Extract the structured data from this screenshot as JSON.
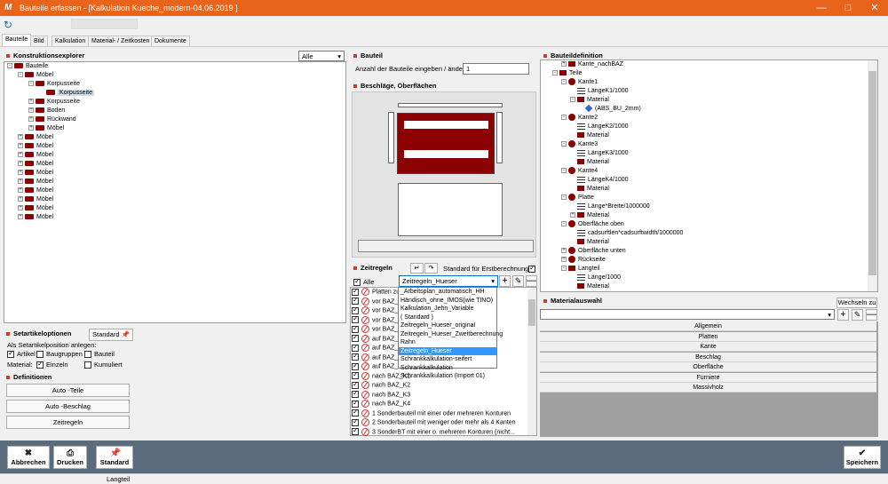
{
  "window": {
    "title": "Bauteile erfassen - [Kalkulation Kueche_modern-04.06.2019 ]"
  },
  "tabs": [
    "Bauteile",
    "Bild",
    "Kalkulation",
    "Material- / Zeitkosten",
    "Dokumente"
  ],
  "explorer": {
    "title": "Konstruktionsexplorer",
    "filter": "Alle",
    "root": "Bauteile",
    "items": [
      {
        "label": "Möbel",
        "level": 1,
        "exp": "-"
      },
      {
        "label": "Korpusseite",
        "level": 2,
        "exp": "-"
      },
      {
        "label": "Korpusseite",
        "level": 3,
        "exp": "",
        "selected": true
      },
      {
        "label": "Korpusseite",
        "level": 2,
        "exp": "+"
      },
      {
        "label": "Boden",
        "level": 2,
        "exp": "+"
      },
      {
        "label": "Rückwand",
        "level": 2,
        "exp": "+"
      },
      {
        "label": "Möbel",
        "level": 2,
        "exp": "+"
      },
      {
        "label": "Möbel",
        "level": 1,
        "exp": "+"
      },
      {
        "label": "Möbel",
        "level": 1,
        "exp": "+"
      },
      {
        "label": "Möbel",
        "level": 1,
        "exp": "+"
      },
      {
        "label": "Möbel",
        "level": 1,
        "exp": "+"
      },
      {
        "label": "Möbel",
        "level": 1,
        "exp": "+"
      },
      {
        "label": "Möbel",
        "level": 1,
        "exp": "+"
      },
      {
        "label": "Möbel",
        "level": 1,
        "exp": "+"
      },
      {
        "label": "Möbel",
        "level": 1,
        "exp": "+"
      },
      {
        "label": "Möbel",
        "level": 1,
        "exp": "+"
      },
      {
        "label": "Möbel",
        "level": 1,
        "exp": "+"
      }
    ]
  },
  "setartikel": {
    "title": "Setartikeloptionen",
    "standard_btn": "Standard",
    "position_label": "Als Setartikelposition anlegen:",
    "artikel": "Artikel",
    "baugruppen": "Baugruppen",
    "bauteil": "Bauteil",
    "material_label": "Material:",
    "einzeln": "Einzeln",
    "kumuliert": "Kumuliert"
  },
  "definitionen": {
    "title": "Definitionen",
    "buttons": [
      "Auto -Teile",
      "Auto -Beschlag",
      "Zeitregeln"
    ]
  },
  "bauteil": {
    "title": "Bauteil",
    "count_label": "Anzahl der Bauteile eingeben / ändern:",
    "count_value": "1"
  },
  "beschlaege": {
    "title": "Beschläge, Oberflächen"
  },
  "zeitregeln": {
    "title": "Zeitregeln",
    "standard_label": "Standard für Erstberechnung",
    "alle": "Alle",
    "selected": "Zeitregeln_Hueser",
    "rules": [
      "Platten zu...",
      "vor BAZ_K",
      "vor BAZ_K",
      "vor BAZ_K",
      "vor BAZ_K",
      "auf BAZ_K",
      "auf BAZ_K",
      "auf BAZ_K",
      "auf BAZ_K",
      "nach BAZ_K1",
      "nach BAZ_K2",
      "nach BAZ_K3",
      "nach BAZ_K4",
      "1 Sonderbauteil mit einer oder mehreren Konturen",
      "2 Sonderbauteil mit weniger oder mehr als 4 Kanten",
      "3 SonderBT mit einer o. mehreren Konturen (nicht..."
    ],
    "dropdown": [
      "_Arbeitsplan_automatisch_HH",
      "Händisch_ohne_IMOS(wie TINO)",
      "Kalkulation_Jehn_Variable",
      "( Standard )",
      "Zeitregeln_Hueser_original",
      "Zeitregeln_Hueser_Zweitberechnung",
      "Rahn",
      "Zeitregeln_Hueser",
      "Schrankkalkulation-seifert",
      "Schrankkalkulation",
      "Schrankkalkulation (Import 01)"
    ],
    "dropdown_hl": 7
  },
  "bauteildefinition": {
    "title": "Bauteildefinition",
    "items": [
      {
        "label": "Kante_nachBAZ",
        "level": 1,
        "icon": "special",
        "exp": "+"
      },
      {
        "label": "Teile",
        "level": 0,
        "icon": "m",
        "exp": "-"
      },
      {
        "label": "Kante1",
        "level": 1,
        "icon": "p",
        "exp": "-"
      },
      {
        "label": "LängeK1/1000",
        "level": 2,
        "icon": "s",
        "exp": ""
      },
      {
        "label": "Material",
        "level": 2,
        "icon": "m",
        "exp": "-"
      },
      {
        "label": "(ABS_BU_2mm)",
        "level": 3,
        "icon": "d",
        "exp": ""
      },
      {
        "label": "Kante2",
        "level": 1,
        "icon": "p",
        "exp": "-"
      },
      {
        "label": "LängeK2/1000",
        "level": 2,
        "icon": "s",
        "exp": ""
      },
      {
        "label": "Material",
        "level": 2,
        "icon": "m",
        "exp": ""
      },
      {
        "label": "Kante3",
        "level": 1,
        "icon": "p",
        "exp": "-"
      },
      {
        "label": "LängeK3/1000",
        "level": 2,
        "icon": "s",
        "exp": ""
      },
      {
        "label": "Material",
        "level": 2,
        "icon": "m",
        "exp": ""
      },
      {
        "label": "Kante4",
        "level": 1,
        "icon": "p",
        "exp": "-"
      },
      {
        "label": "LängeK4/1000",
        "level": 2,
        "icon": "s",
        "exp": ""
      },
      {
        "label": "Material",
        "level": 2,
        "icon": "m",
        "exp": ""
      },
      {
        "label": "Platte",
        "level": 1,
        "icon": "p",
        "exp": "-"
      },
      {
        "label": "Länge*Breite/1000000",
        "level": 2,
        "icon": "s",
        "exp": ""
      },
      {
        "label": "Material",
        "level": 2,
        "icon": "m",
        "exp": "+"
      },
      {
        "label": "Oberfläche oben",
        "level": 1,
        "icon": "p",
        "exp": "-"
      },
      {
        "label": "cadsurftlen*cadsurftwidth/1000000",
        "level": 2,
        "icon": "s",
        "exp": ""
      },
      {
        "label": "Material",
        "level": 2,
        "icon": "m",
        "exp": ""
      },
      {
        "label": "Oberfläche unten",
        "level": 1,
        "icon": "p",
        "exp": "+"
      },
      {
        "label": "Rückseite",
        "level": 1,
        "icon": "p",
        "exp": "+"
      },
      {
        "label": "Langteil",
        "level": 1,
        "icon": "special",
        "exp": "-"
      },
      {
        "label": "Länge/1000",
        "level": 2,
        "icon": "s",
        "exp": ""
      },
      {
        "label": "Material",
        "level": 2,
        "icon": "m",
        "exp": ""
      }
    ]
  },
  "materialauswahl": {
    "title": "Materialauswahl",
    "wechseln": "Wechseln zu",
    "rows": [
      "Allgemein",
      "Platten",
      "Kante",
      "Beschlag",
      "Oberfläche",
      "Furniere",
      "Massivholz"
    ]
  },
  "bottom": {
    "abbrechen": "Abbrechen",
    "drucken": "Drucken",
    "standard": "Standard",
    "speichern": "Speichern"
  },
  "status": {
    "text": "Langteil"
  }
}
